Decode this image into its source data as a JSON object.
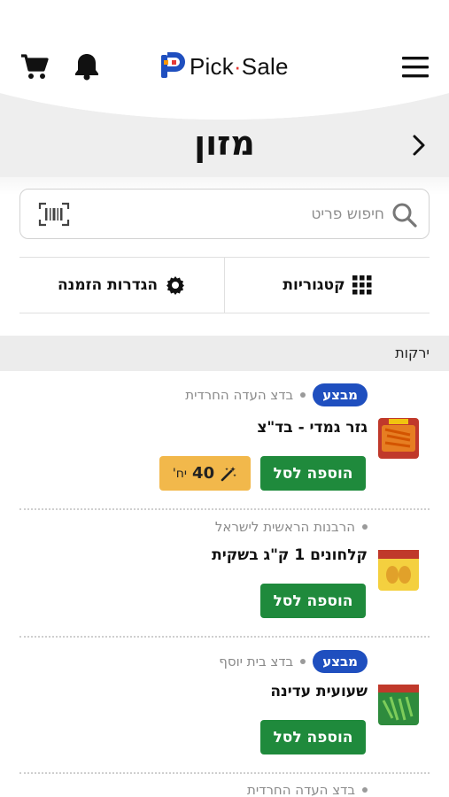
{
  "header": {
    "logo_pick": "Pick",
    "logo_sale": "Sale",
    "menu_icon": "hamburger-menu-icon",
    "cart_icon": "shopping-cart-icon",
    "bell_icon": "bell-icon",
    "back_icon": "chevron-right-icon"
  },
  "page": {
    "title": "מזון"
  },
  "search": {
    "placeholder": "חיפוש פריט",
    "value": "",
    "search_icon": "magnifier-icon",
    "barcode_icon": "barcode-scanner-icon"
  },
  "tabs": [
    {
      "label": "קטגוריות",
      "icon": "grid-icon"
    },
    {
      "label": "הגדרות הזמנה",
      "icon": "gear-icon"
    }
  ],
  "section": {
    "label": "ירקות"
  },
  "products": [
    {
      "badge": "מבצע",
      "cert": "בדצ העדה החרדית",
      "name": "גזר גמדי - בד\"צ",
      "add_label": "הוספה לסל",
      "promo_qty": "40",
      "promo_unit": "יח'"
    },
    {
      "badge": "",
      "cert": "הרבנות הראשית לישראל",
      "name": "קלחונים 1 ק\"ג בשקית",
      "add_label": "הוספה לסל"
    },
    {
      "badge": "מבצע",
      "cert": "בדצ בית יוסף",
      "name": "שעועית עדינה",
      "add_label": "הוספה לסל"
    },
    {
      "badge": "",
      "cert": "בדצ העדה החרדית"
    }
  ],
  "colors": {
    "brand_blue": "#1f4fbf",
    "add_green": "#1f8a3c",
    "promo_yellow": "#f2b84b",
    "section_gray": "#ececec"
  }
}
